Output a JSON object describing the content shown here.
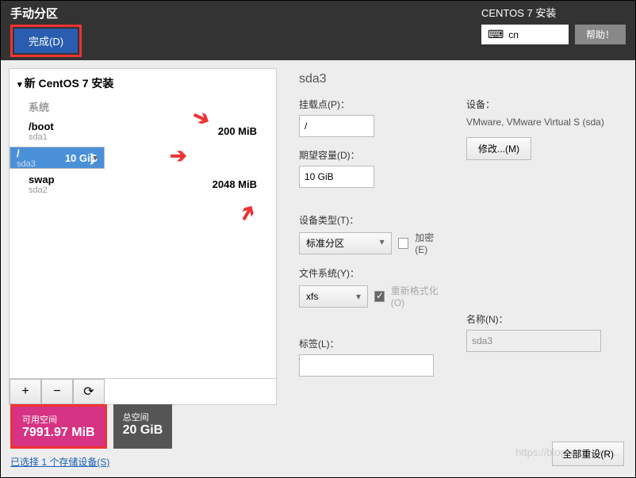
{
  "header": {
    "title": "手动分区",
    "done": "完成(D)",
    "install_title": "CENTOS 7 安装",
    "keyboard": "cn",
    "help": "帮助！"
  },
  "left": {
    "group": "新 CentOS 7 安装",
    "sys": "系统",
    "parts": [
      {
        "name": "/boot",
        "dev": "sda1",
        "size": "200 MiB"
      },
      {
        "name": "/",
        "dev": "sda3",
        "size": "10 GiB"
      },
      {
        "name": "swap",
        "dev": "sda2",
        "size": "2048 MiB"
      }
    ],
    "tb": {
      "add": "+",
      "del": "−",
      "rel": "⟳"
    }
  },
  "right": {
    "pname": "sda3",
    "mount_lbl": "挂载点(P)：",
    "mount_val": "/",
    "cap_lbl": "期望容量(D)：",
    "cap_val": "10 GiB",
    "devtype_lbl": "设备类型(T)：",
    "devtype_val": "标准分区",
    "enc_lbl": "加密(E)",
    "fs_lbl": "文件系统(Y)：",
    "fs_val": "xfs",
    "refmt_lbl": "重新格式化(O)",
    "label_lbl": "标签(L)：",
    "label_val": "",
    "dev_lbl": "设备：",
    "dev_txt": "VMware, VMware Virtual S (sda)",
    "mod": "修改...(M)",
    "name_lbl": "名称(N)：",
    "name_val": "sda3"
  },
  "bottom": {
    "avail_lbl": "可用空间",
    "avail_val": "7991.97 MiB",
    "total_lbl": "总空间",
    "total_val": "20 GiB",
    "storage": "已选择 1 个存储设备(S)",
    "reset": "全部重设(R)"
  },
  "wm": "https://blog.csdn.net/..."
}
